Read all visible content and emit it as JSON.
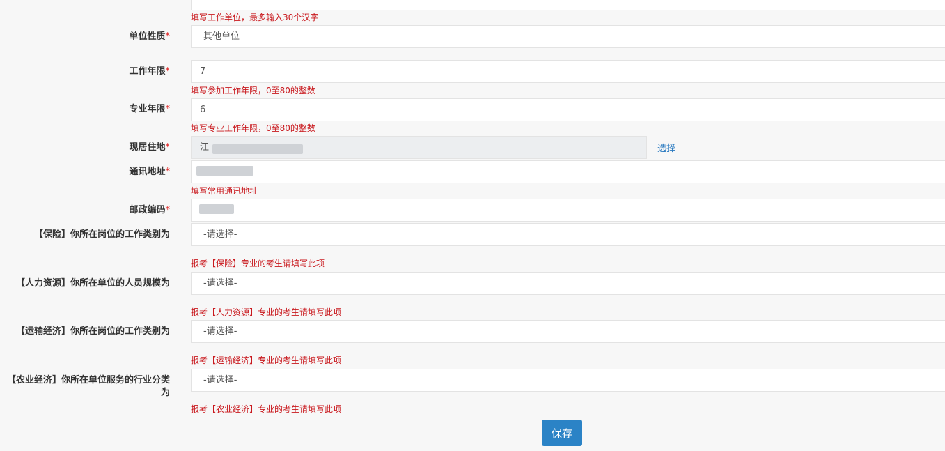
{
  "top_field": {
    "hint": "填写工作单位，最多输入30个汉字"
  },
  "unit_type": {
    "label": "单位性质",
    "value": "其他单位"
  },
  "work_years": {
    "label": "工作年限",
    "value": "7",
    "hint": "填写参加工作年限，0至80的整数"
  },
  "pro_years": {
    "label": "专业年限",
    "value": "6",
    "hint": "填写专业工作年限，0至80的整数"
  },
  "residence": {
    "label": "现居住地",
    "value": "江",
    "link": "选择"
  },
  "address": {
    "label": "通讯地址",
    "hint": "填写常用通讯地址"
  },
  "postcode": {
    "label": "邮政编码"
  },
  "insurance": {
    "label": "【保险】你所在岗位的工作类别为",
    "value": "-请选择-",
    "hint": "报考【保险】专业的考生请填写此项"
  },
  "hr": {
    "label": "【人力资源】你所在单位的人员规模为",
    "value": "-请选择-",
    "hint": "报考【人力资源】专业的考生请填写此项"
  },
  "transport": {
    "label": "【运输经济】你所在岗位的工作类别为",
    "value": "-请选择-",
    "hint": "报考【运输经济】专业的考生请填写此项"
  },
  "agri": {
    "label": "【农业经济】你所在单位服务的行业分类为",
    "value": "-请选择-",
    "hint": "报考【农业经济】专业的考生请填写此项"
  },
  "required_mark": "*",
  "save_label": "保存",
  "colors": {
    "hint": "#c9191e",
    "link": "#2a7ac0",
    "button": "#2b83c6"
  }
}
